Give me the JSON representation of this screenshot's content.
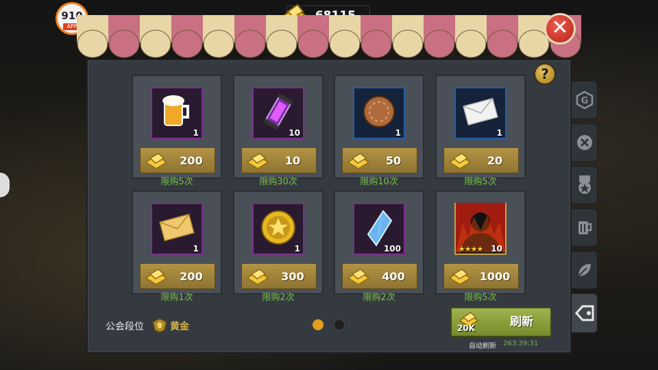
{
  "currency": {
    "amount": "68115",
    "icon": "gold-ingot-icon"
  },
  "logo": {
    "number": "910",
    "tag": "APP"
  },
  "items": [
    {
      "icon": "beer-mug-icon",
      "qty": "1",
      "price": "200",
      "limit": "限购5次",
      "frame": "purple"
    },
    {
      "icon": "purple-tube-icon",
      "qty": "10",
      "price": "10",
      "limit": "限购30次",
      "frame": "purple"
    },
    {
      "icon": "bronze-chip-icon",
      "qty": "1",
      "price": "50",
      "limit": "限购10次",
      "frame": "blue"
    },
    {
      "icon": "white-envelope-icon",
      "qty": "1",
      "price": "20",
      "limit": "限购5次",
      "frame": "blue"
    },
    {
      "icon": "gold-envelope-icon",
      "qty": "1",
      "price": "200",
      "limit": "限购1次",
      "frame": "purple"
    },
    {
      "icon": "gold-coin-icon",
      "qty": "1",
      "price": "300",
      "limit": "限购2次",
      "frame": "purple"
    },
    {
      "icon": "blue-crystal-icon",
      "qty": "100",
      "price": "400",
      "limit": "限购2次",
      "frame": "purple"
    },
    {
      "icon": "character-silhouette-icon",
      "qty": "10",
      "price": "1000",
      "limit": "限购5次",
      "frame": "gold",
      "stars": 4
    }
  ],
  "guild": {
    "label": "公会段位",
    "rank": "黄金"
  },
  "pagination": {
    "active_color": "#e0a020",
    "inactive_color": "#1e1e1e",
    "pages": 2,
    "current": 1
  },
  "refresh": {
    "label": "刷新",
    "cost": "20K",
    "auto_label": "自动刷新",
    "timer": "263:39:31"
  },
  "side_tabs": [
    "g-badge-icon",
    "cross-emblem-icon",
    "medal-icon",
    "beer-mug-icon",
    "leaf-icon",
    "shop-tag-icon"
  ],
  "colors": {
    "limit_text": "#7bc24d",
    "rank_text": "#d4b44a",
    "price_button": "#a28638",
    "refresh_button": "#8ea23e"
  }
}
